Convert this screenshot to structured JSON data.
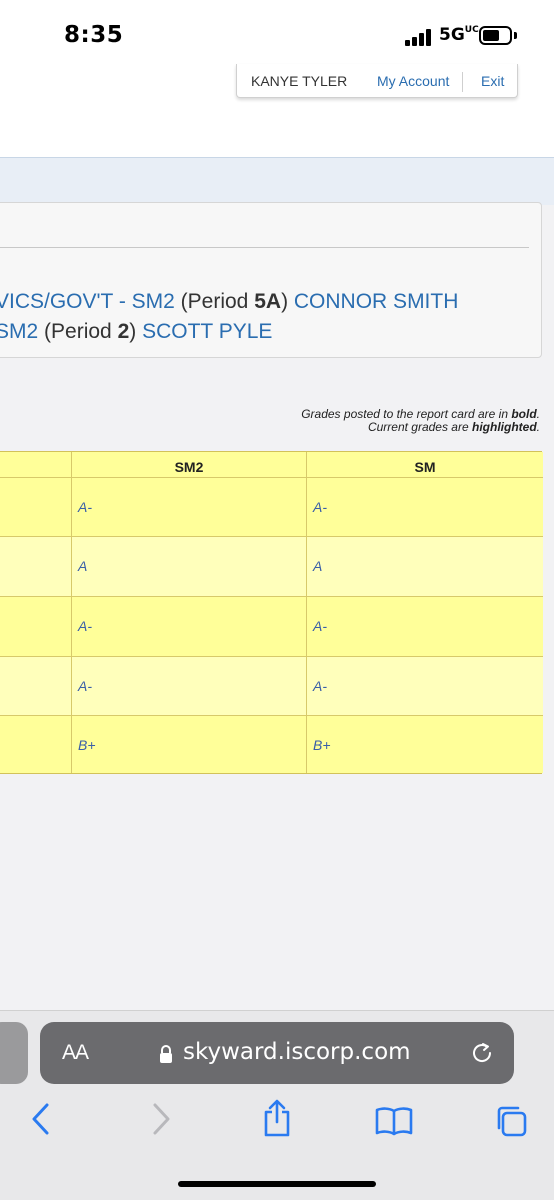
{
  "status_bar": {
    "time": "8:35",
    "network": "5G",
    "network_suffix": "UC"
  },
  "account": {
    "user_name": "KANYE TYLER",
    "my_account": "My Account",
    "exit": "Exit"
  },
  "classes": [
    {
      "course": "VICS/GOV'T - SM2",
      "period_prefix": " (Period ",
      "period": "5A",
      "period_suffix": ") ",
      "teacher": "CONNOR SMITH"
    },
    {
      "course": " SM2",
      "period_prefix": " (Period ",
      "period": "2",
      "period_suffix": ") ",
      "teacher": "SCOTT PYLE"
    }
  ],
  "legend": {
    "line1_text": "Grades posted to the report card are in ",
    "line1_bold": "bold",
    "line1_end": ".",
    "line2_text": "Current grades are ",
    "line2_bold": "highlighted",
    "line2_end": "."
  },
  "grades_table": {
    "columns": [
      "",
      "SM2",
      "SM"
    ],
    "rows": [
      {
        "sm2": "A-",
        "sm": "A-"
      },
      {
        "sm2": "A",
        "sm": "A"
      },
      {
        "sm2": "A-",
        "sm": "A-"
      },
      {
        "sm2": "A-",
        "sm": "A-"
      },
      {
        "sm2": "B+",
        "sm": "B+"
      }
    ]
  },
  "browser": {
    "text_size": "AA",
    "url": "skyward.iscorp.com"
  },
  "colors": {
    "link": "#2a6db0",
    "grade_yellow": "#ffff99",
    "grade_pale": "#ffffbb",
    "band": "#e8eef6"
  }
}
